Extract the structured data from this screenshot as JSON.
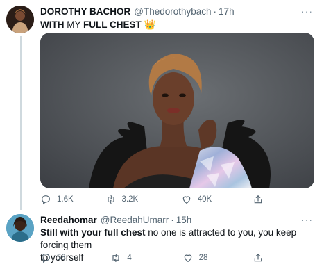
{
  "tweet1": {
    "author_name": "DOROTHY BACHOR",
    "handle": "@Thedorothybach",
    "dot": "·",
    "time": "17h",
    "text_part1": "WITH",
    "text_part2": " MY ",
    "text_part3": "FULL CHEST",
    "emoji": "👑",
    "more": "···",
    "counts": {
      "replies": "1.6K",
      "retweets": "3.2K",
      "likes": "40K"
    }
  },
  "tweet2": {
    "author_name": "Reedahomar",
    "handle": "@ReedahUmarr",
    "dot": "·",
    "time": "15h",
    "text_bold": "Still with your full chest",
    "text_rest_line1": " no one is attracted to you, you keep forcing them",
    "text_line2": "to yourself",
    "more": "···",
    "counts": {
      "replies": "58",
      "retweets": "4",
      "likes": "28"
    }
  },
  "colors": {
    "text": "#0f1419",
    "secondary": "#536471",
    "divider": "#cfd9de"
  }
}
